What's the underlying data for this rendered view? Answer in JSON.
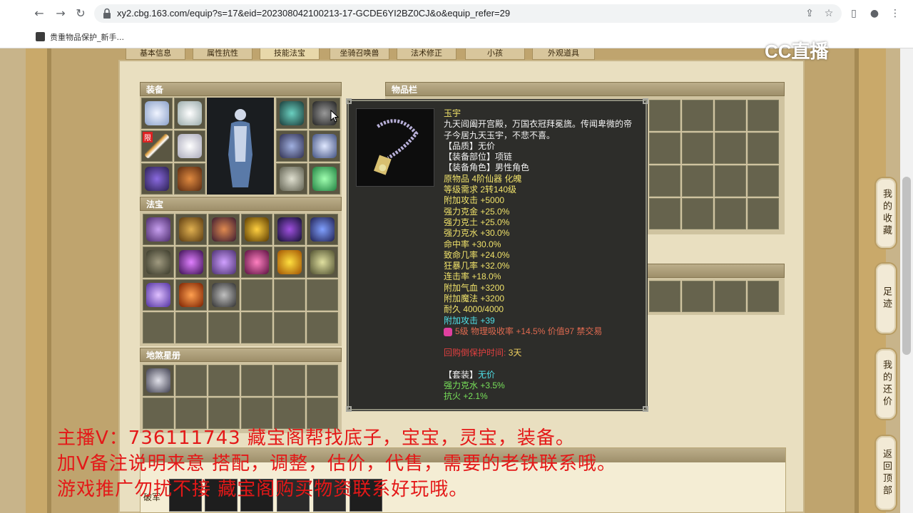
{
  "browser": {
    "url": "xy2.cbg.163.com/equip?s=17&eid=202308042100213-17-GCDE6YI2BZ0CJ&o&equip_refer=29",
    "bookmark_label": "贵重物品保护_新手..."
  },
  "top_tabs": [
    "基本信息",
    "属性抗性",
    "技能法宝",
    "坐骑召唤兽",
    "法术修正",
    "小孩",
    "外观道具"
  ],
  "panels": {
    "equipment": "装备",
    "fabao": "法宝",
    "disha": "地煞星册",
    "inventory": "物品栏"
  },
  "equip_badge": "限",
  "tooltip": {
    "name": "玉宇",
    "description_1": "九天阊阖开宫殿，万国衣冠拜冕旒。传闻卑微的帝",
    "description_2": "子今居九天玉宇，不悲不喜。",
    "lines": [
      {
        "text": "【品质】无价",
        "color": "white"
      },
      {
        "text": "【装备部位】项链",
        "color": "white"
      },
      {
        "text": "【装备角色】男性角色",
        "color": "white"
      },
      {
        "text": "原物品 4阶仙器 化魄",
        "color": "yellow"
      },
      {
        "text": "等级需求 2转140级",
        "color": "yellow"
      },
      {
        "text": "附加攻击 +5000",
        "color": "yellow"
      },
      {
        "text": "强力克金 +25.0%",
        "color": "yellow"
      },
      {
        "text": "强力克土 +25.0%",
        "color": "yellow"
      },
      {
        "text": "强力克水 +30.0%",
        "color": "yellow"
      },
      {
        "text": "命中率 +30.0%",
        "color": "yellow"
      },
      {
        "text": "致命几率 +24.0%",
        "color": "yellow"
      },
      {
        "text": "狂暴几率 +32.0%",
        "color": "yellow"
      },
      {
        "text": "连击率 +18.0%",
        "color": "yellow"
      },
      {
        "text": "附加气血 +3200",
        "color": "yellow"
      },
      {
        "text": "附加魔法 +3200",
        "color": "yellow"
      },
      {
        "text": "耐久 4000/4000",
        "color": "yellow"
      },
      {
        "text": "附加攻击 +39",
        "color": "cyan"
      }
    ],
    "gem_line": "5级 物理吸收率 +14.5% 价值97 禁交易",
    "protect_label": "回购倒保护时间:",
    "protect_value": "3天",
    "set_label": "【套装】",
    "set_value": "无价",
    "set_lines": [
      "强力克水 +3.5%",
      "抗火 +2.1%"
    ]
  },
  "side_nav": [
    "我的收藏",
    "足迹",
    "我的还价",
    "返回顶部"
  ],
  "overlay": {
    "logo": "CC直播",
    "promo_1": "主播V：736111743        藏宝阁帮找底子，宝宝，灵宝，装备。",
    "promo_2": "加V备注说明来意     搭配，调整，估价，代售，需要的老铁联系哦。",
    "promo_3": "游戏推广勿扰不接              藏宝阁购买物资联系好玩哦。"
  },
  "bottom": {
    "label": "破军"
  },
  "colors": {
    "promo_red": "#e41818",
    "tooltip_bg": "#2d2d2a",
    "stat_yellow": "#f0e26a",
    "stat_cyan": "#4fe0e8",
    "set_green": "#78e15a"
  }
}
